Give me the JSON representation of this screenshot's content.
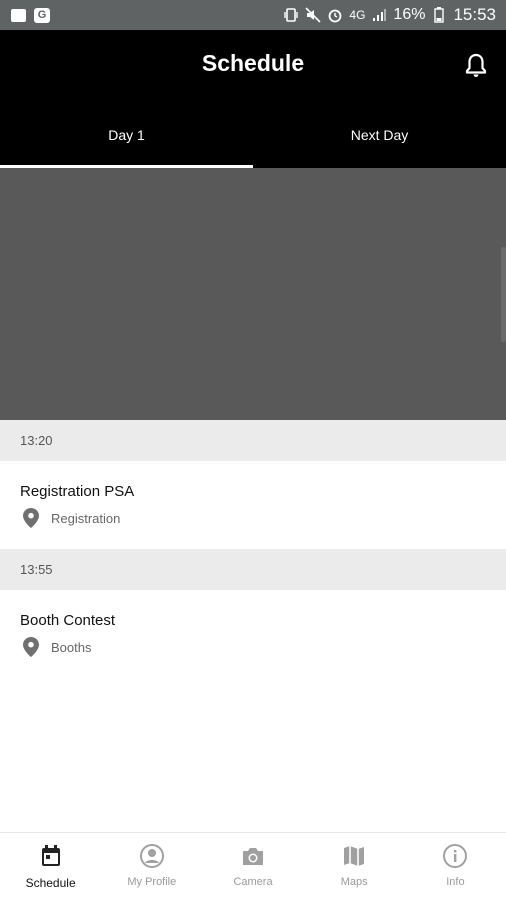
{
  "status_bar": {
    "g_badge": "G",
    "signal_text": "4G",
    "battery_pct": "16%",
    "time": "15:53"
  },
  "header": {
    "title": "Schedule",
    "tabs": [
      {
        "label": "Day 1",
        "active": true
      },
      {
        "label": "Next Day",
        "active": false
      }
    ]
  },
  "schedule": [
    {
      "time": "13:20",
      "title": "Registration PSA",
      "location": "Registration"
    },
    {
      "time": "13:55",
      "title": "Booth Contest",
      "location": "Booths"
    }
  ],
  "bottom_nav": {
    "items": [
      {
        "label": "Schedule",
        "icon": "calendar-icon",
        "active": true
      },
      {
        "label": "My Profile",
        "icon": "profile-icon",
        "active": false
      },
      {
        "label": "Camera",
        "icon": "camera-icon",
        "active": false
      },
      {
        "label": "Maps",
        "icon": "map-icon",
        "active": false
      },
      {
        "label": "Info",
        "icon": "info-icon",
        "active": false
      }
    ]
  },
  "colors": {
    "header_bg": "#000000",
    "banner_bg": "#595959",
    "time_header_bg": "#ebebeb",
    "status_bar_bg": "#5f6364"
  }
}
